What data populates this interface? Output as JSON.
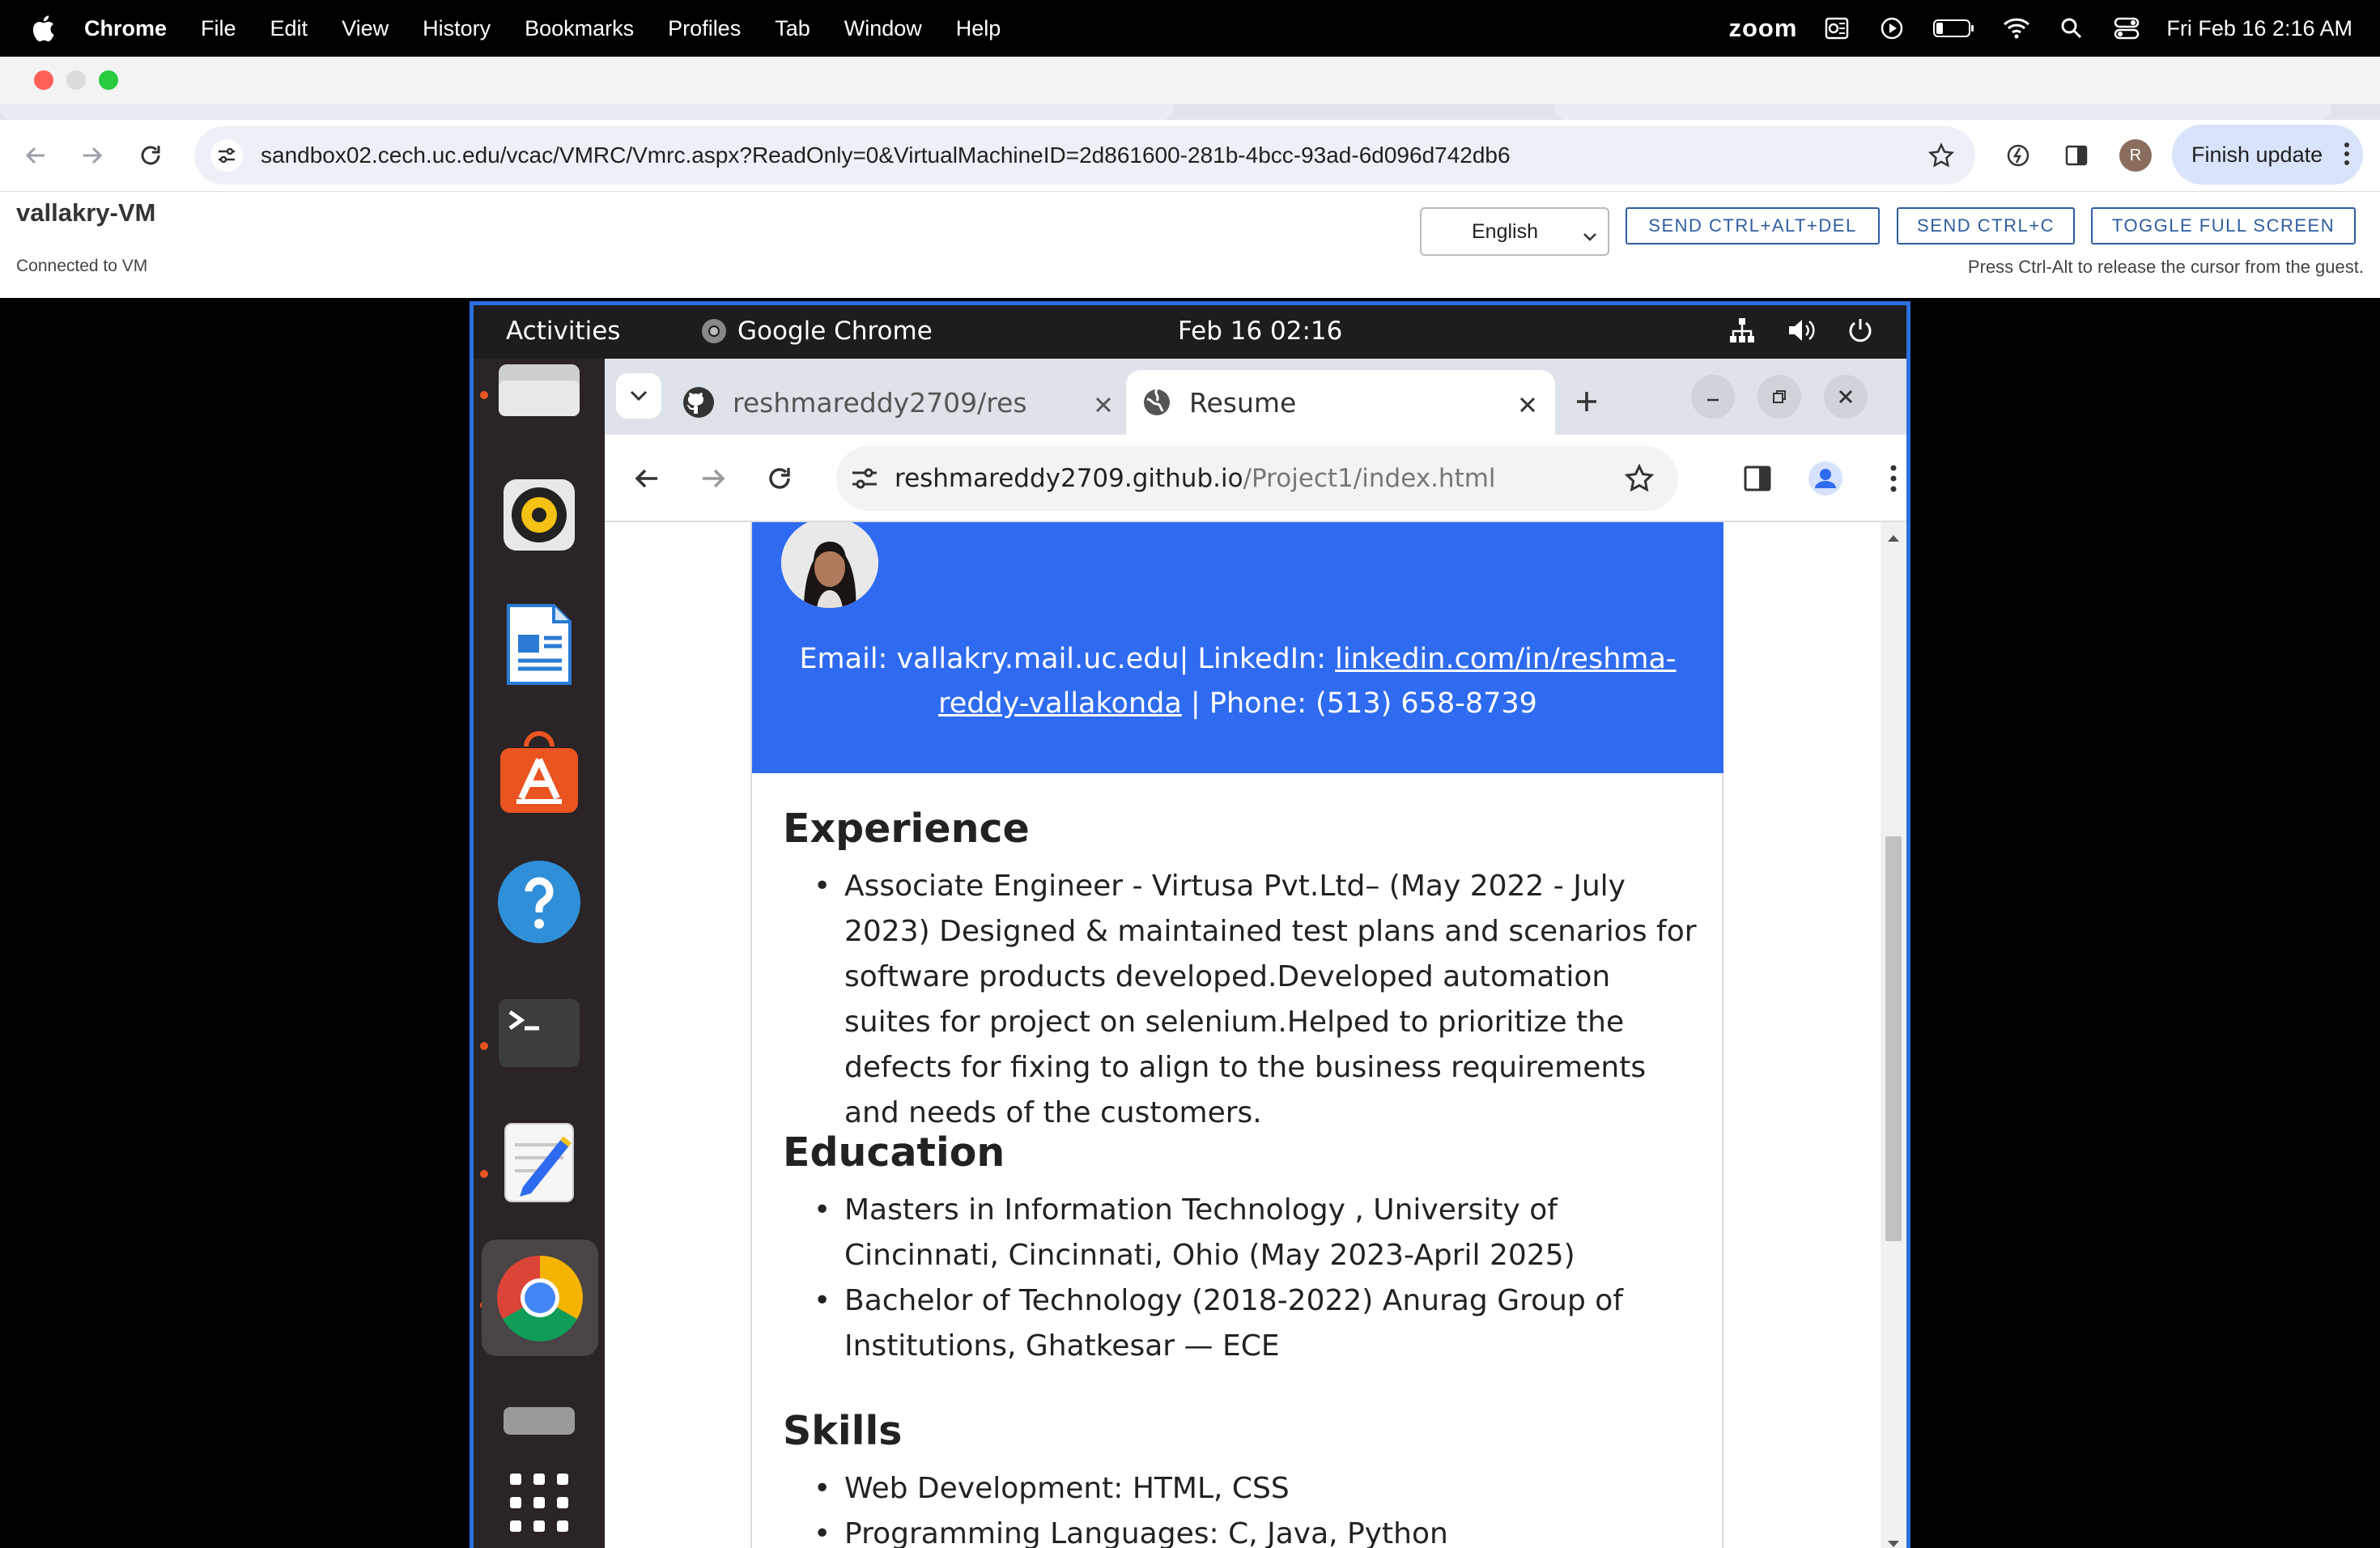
{
  "menubar": {
    "app": "Chrome",
    "items": [
      "File",
      "Edit",
      "View",
      "History",
      "Bookmarks",
      "Profiles",
      "Tab",
      "Window",
      "Help"
    ],
    "zoom": "zoom",
    "datetime": "Fri Feb 16  2:16 AM"
  },
  "host_browser": {
    "url": "sandbox02.cech.uc.edu/vcac/VMRC/Vmrc.aspx?ReadOnly=0&VirtualMachineID=2d861600-281b-4bcc-93ad-6d096d742db6",
    "profile_initial": "R",
    "finish_update_label": "Finish update"
  },
  "vmrc": {
    "title": "vallakry-VM",
    "status": "Connected to VM",
    "hint": "Press Ctrl-Alt to release the cursor from the guest.",
    "language": "English",
    "buttons": {
      "ctrl_alt_del": "SEND CTRL+ALT+DEL",
      "ctrl_c": "SEND CTRL+C",
      "fullscreen": "TOGGLE FULL SCREEN"
    }
  },
  "gnome": {
    "activities": "Activities",
    "app": "Google Chrome",
    "clock": "Feb 16  02:16"
  },
  "guest_browser": {
    "tabs": [
      {
        "label": "reshmareddy2709/res"
      },
      {
        "label": "Resume"
      }
    ],
    "url_host": "reshmareddy2709.github.io",
    "url_path": "/Project1/index.html"
  },
  "resume": {
    "contact_prefix": "Email: vallakry.mail.uc.edu| LinkedIn: ",
    "linkedin": "linkedin.com/in/reshma-reddy-vallakonda",
    "contact_suffix": " | Phone: (513) 658-8739",
    "experience_title": "Experience",
    "experience": [
      "Associate Engineer - Virtusa Pvt.Ltd– (May 2022 - July 2023) Designed & maintained test plans and scenarios for software products developed.Developed automation suites for project on selenium.Helped to prioritize the defects for fixing to align to the business requirements and needs of the customers."
    ],
    "education_title": "Education",
    "education": [
      "Masters in Information Technology , University of Cincinnati, Cincinnati, Ohio (May 2023-April 2025)",
      "Bachelor of Technology (2018-2022) Anurag Group of Institutions, Ghatkesar — ECE"
    ],
    "skills_title": "Skills",
    "skills": [
      "Web Development: HTML, CSS",
      "Programming Languages: C, Java, Python"
    ]
  }
}
